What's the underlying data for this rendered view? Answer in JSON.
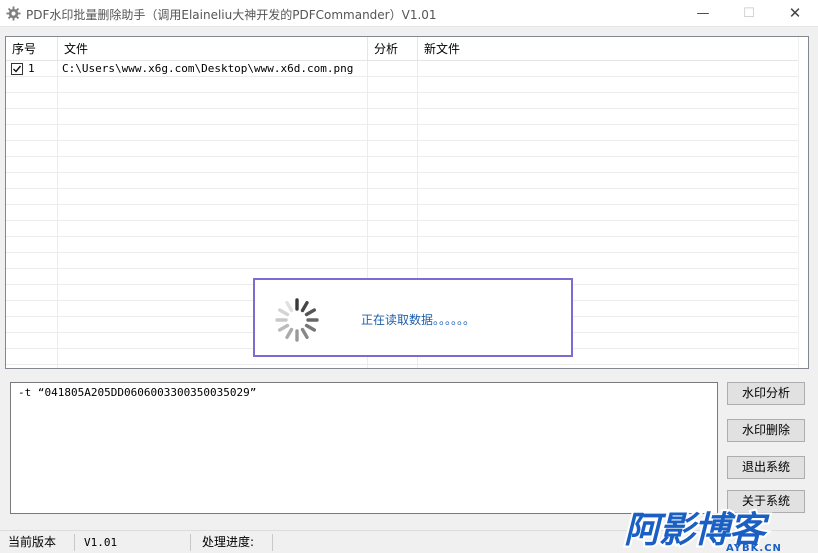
{
  "window": {
    "title": "PDF水印批量删除助手（调用Elaineliu大神开发的PDFCommander）V1.01",
    "minimize": "—",
    "maximize": "☐",
    "close": "✕",
    "icon": "gear-icon"
  },
  "table": {
    "columns": [
      "序号",
      "文件",
      "分析",
      "新文件"
    ],
    "rows": [
      {
        "checked": true,
        "no": "1",
        "file": "C:\\Users\\www.x6g.com\\Desktop\\www.x6d.com.png",
        "analysis": "",
        "new_file": ""
      }
    ]
  },
  "loading": {
    "text": "正在读取数据。。。。。。",
    "icon": "spinner-icon"
  },
  "command": {
    "text": "-t “041805A205DD0606003300350035029”"
  },
  "buttons": {
    "analyze": "水印分析",
    "delete": "水印删除",
    "exit": "退出系统",
    "about": "关于系统"
  },
  "status": {
    "version_label": "当前版本",
    "version_value": "V1.01",
    "progress_label": "处理进度:",
    "progress_value": ""
  },
  "watermark": {
    "text": "阿影博客",
    "site": "AYBK.CN",
    "color": "#1a5fc4"
  }
}
